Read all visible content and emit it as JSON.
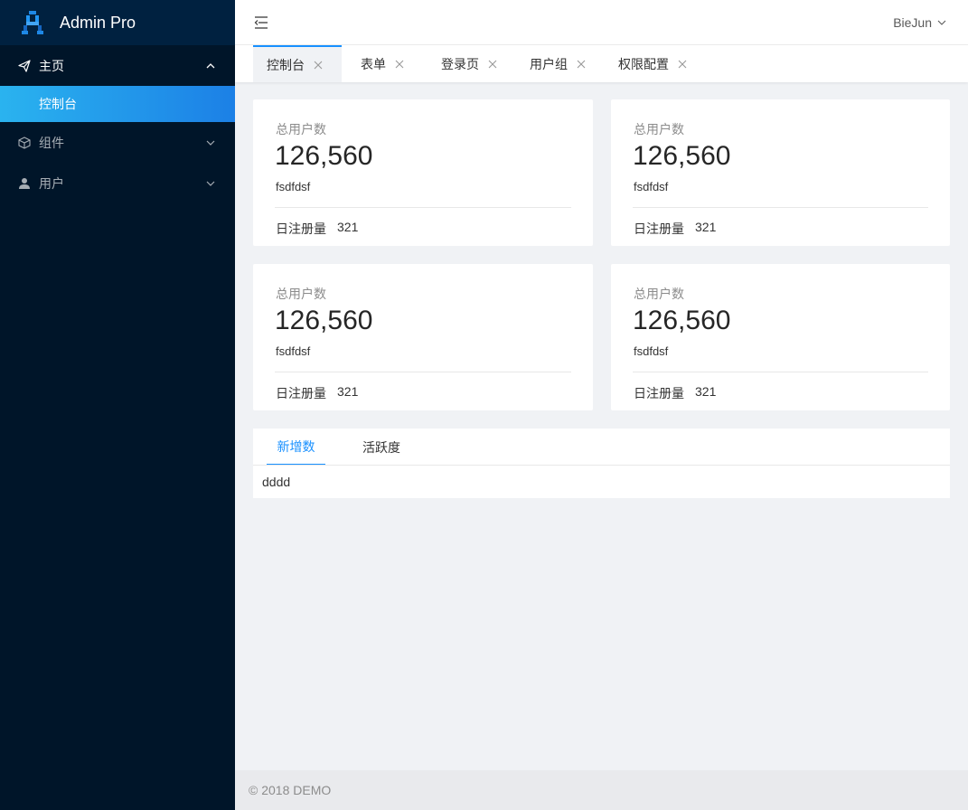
{
  "app": {
    "title": "Admin Pro",
    "logo_icon": "admin-logo-icon"
  },
  "sidebar": {
    "menus": [
      {
        "label": "主页",
        "icon": "send-icon",
        "state": "open"
      },
      {
        "label": "组件",
        "icon": "cube-icon",
        "state": "collapsed"
      },
      {
        "label": "用户",
        "icon": "user-icon",
        "state": "collapsed"
      }
    ],
    "active_subitem": "控制台",
    "colors": {
      "bg": "#001529",
      "active_gradient_start": "#2ab3ef",
      "active_gradient_end": "#1c80e6"
    }
  },
  "header": {
    "user_name": "BieJun"
  },
  "tabs": [
    {
      "label": "控制台",
      "active": true
    },
    {
      "label": "表单",
      "active": false
    },
    {
      "label": "登录页",
      "active": false
    },
    {
      "label": "用户组",
      "active": false
    },
    {
      "label": "权限配置",
      "active": false
    }
  ],
  "cards": [
    {
      "title": "总用户数",
      "value": "126,560",
      "sub": "fsdfdsf",
      "foot_label": "日注册量",
      "foot_value": "321"
    },
    {
      "title": "总用户数",
      "value": "126,560",
      "sub": "fsdfdsf",
      "foot_label": "日注册量",
      "foot_value": "321"
    },
    {
      "title": "总用户数",
      "value": "126,560",
      "sub": "fsdfdsf",
      "foot_label": "日注册量",
      "foot_value": "321"
    },
    {
      "title": "总用户数",
      "value": "126,560",
      "sub": "fsdfdsf",
      "foot_label": "日注册量",
      "foot_value": "321"
    }
  ],
  "panel": {
    "tabs": [
      {
        "label": "新增数",
        "active": true
      },
      {
        "label": "活跃度",
        "active": false
      }
    ],
    "content": "dddd"
  },
  "footer": {
    "text": "© 2018 DEMO"
  },
  "accent_color": "#1890ff"
}
